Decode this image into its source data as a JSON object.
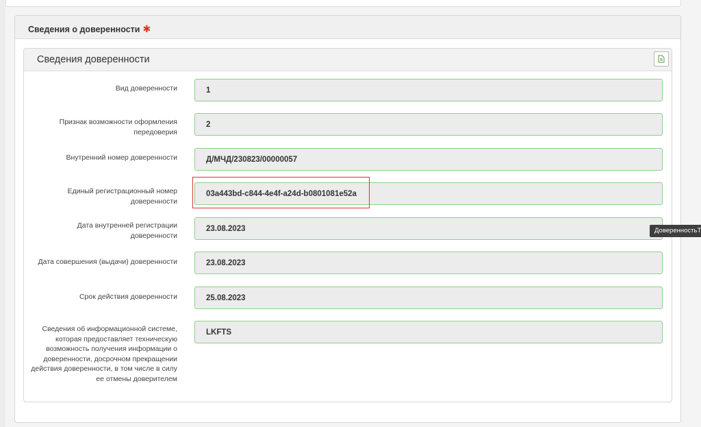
{
  "outer_section": {
    "title": "Сведения о доверенности",
    "required_mark": "✱"
  },
  "inner_section": {
    "title": "Сведения доверенности",
    "action_icon": "document-icon"
  },
  "fields": [
    {
      "label": "Вид доверенности",
      "value": "1"
    },
    {
      "label": "Признак возможности оформления передоверия",
      "value": "2"
    },
    {
      "label": "Внутренний номер доверенности",
      "value": "Д/МЧД/230823/00000057"
    },
    {
      "label": "Единый регистрационный номер доверенности",
      "value": "03a443bd-c844-4e4f-a24d-b0801081e52a"
    },
    {
      "label": "Дата внутренней регистрации доверенности",
      "value": "23.08.2023"
    },
    {
      "label": "Дата совершения (выдачи) доверенности",
      "value": "23.08.2023"
    },
    {
      "label": "Срок действия доверенности",
      "value": "25.08.2023"
    },
    {
      "label": "Сведения об информационной системе, которая предоставляет техническую возможность получения информации о доверенности, досрочном прекращении действия доверенности, в том числе в силу ее отмены доверителем",
      "value": "LKFTS"
    }
  ],
  "tooltip": "ДоверенностьТ",
  "colors": {
    "field_border": "#8fd08a",
    "field_bg": "#ececec",
    "highlight": "#dd3333",
    "required": "#e03222"
  }
}
